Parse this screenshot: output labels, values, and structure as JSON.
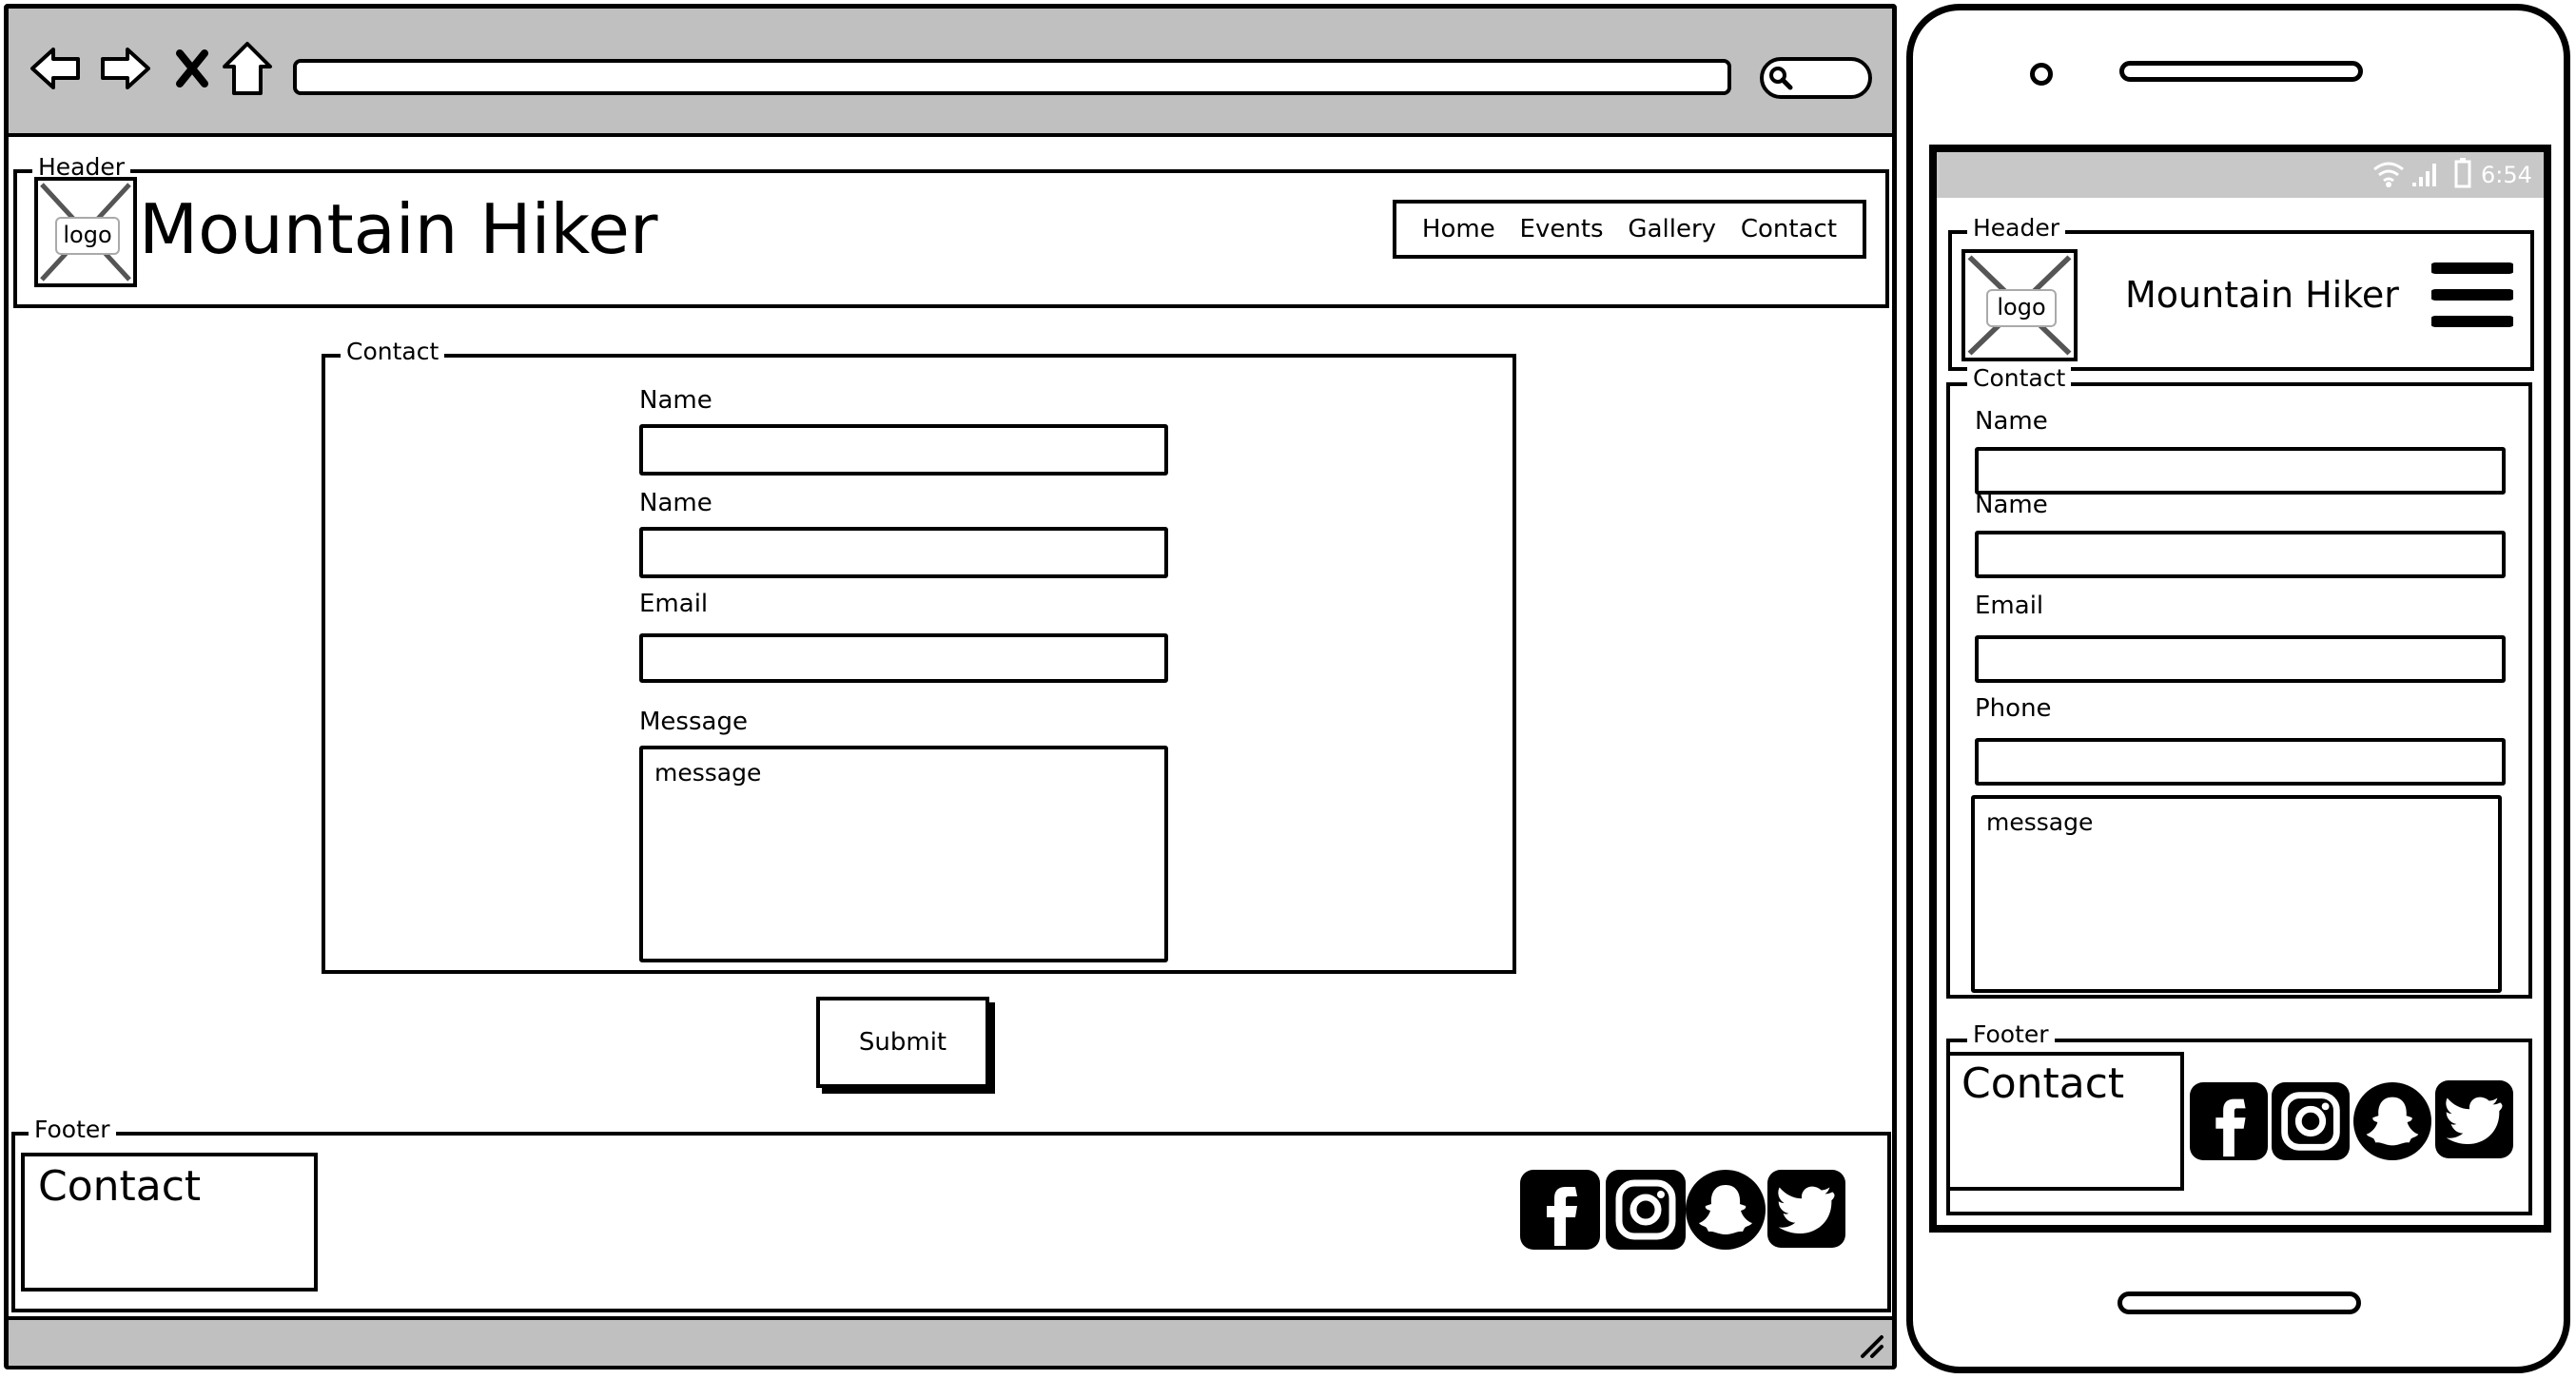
{
  "desktop": {
    "header": {
      "legend": "Header",
      "logo_text": "logo",
      "site_title": "Mountain Hiker",
      "nav": [
        {
          "label": "Home"
        },
        {
          "label": "Events"
        },
        {
          "label": "Gallery"
        },
        {
          "label": "Contact"
        }
      ]
    },
    "contact": {
      "legend": "Contact",
      "fields": [
        {
          "label": "Name"
        },
        {
          "label": "Name"
        },
        {
          "label": "Email"
        },
        {
          "label": "Message"
        }
      ],
      "message_placeholder": "message",
      "submit_label": "Submit"
    },
    "footer": {
      "legend": "Footer",
      "contact_text": "Contact",
      "social": [
        "facebook-icon",
        "instagram-icon",
        "snapchat-icon",
        "twitter-icon"
      ]
    }
  },
  "mobile": {
    "status_bar": {
      "time": "6:54"
    },
    "header": {
      "legend": "Header",
      "logo_text": "logo",
      "site_title": "Mountain Hiker"
    },
    "contact": {
      "legend": "Contact",
      "fields": [
        {
          "label": "Name"
        },
        {
          "label": "Name"
        },
        {
          "label": "Email"
        },
        {
          "label": "Phone"
        }
      ],
      "message_placeholder": "message"
    },
    "footer": {
      "legend": "Footer",
      "contact_text": "Contact",
      "social": [
        "facebook-icon",
        "instagram-icon",
        "snapchat-icon",
        "twitter-icon"
      ]
    }
  },
  "colors": {
    "chrome_grey": "#c0c0c0",
    "ink": "#000000"
  }
}
